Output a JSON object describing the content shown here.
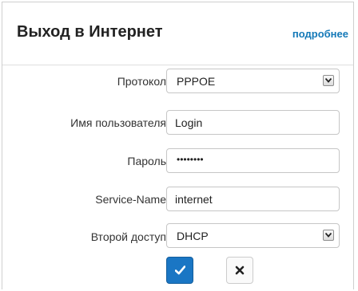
{
  "header": {
    "title": "Выход в Интернет",
    "more_link": "подробнее"
  },
  "form": {
    "protocol": {
      "label": "Протокол",
      "value": "PPPOE",
      "icon": "chevron-down-icon"
    },
    "username": {
      "label": "Имя пользователя",
      "value": "Login"
    },
    "password": {
      "label": "Пароль",
      "masked_value": "••••••••"
    },
    "service_name": {
      "label": "Service-Name",
      "value": "internet"
    },
    "secondary_access": {
      "label": "Второй доступ",
      "value": "DHCP",
      "icon": "chevron-down-icon"
    }
  },
  "buttons": {
    "ok_icon": "checkmark-icon",
    "cancel_icon": "close-icon"
  },
  "colors": {
    "accent": "#1a76c4",
    "link": "#1479b8",
    "title": "#222222"
  }
}
